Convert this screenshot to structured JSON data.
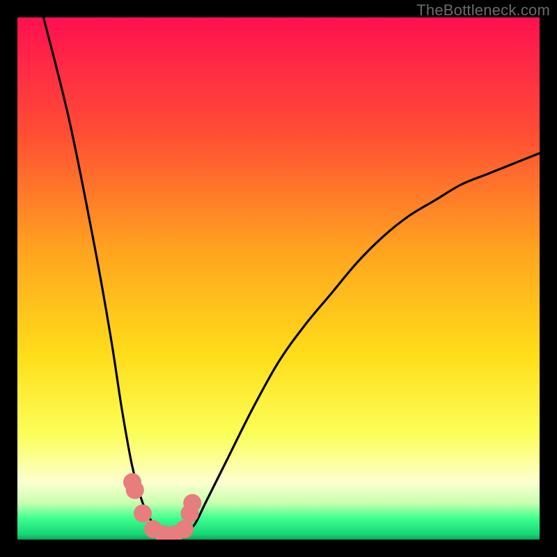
{
  "watermark": "TheBottleneck.com",
  "colors": {
    "page_bg": "#000000",
    "gradient_top": "#ff1050",
    "gradient_mid1": "#ff5030",
    "gradient_mid2": "#ffa81f",
    "gradient_mid3": "#ffe21a",
    "gradient_mid4": "#fcff60",
    "gradient_pale": "#fdffd8",
    "gradient_green": "#18ff82",
    "gradient_dark_bottom": "#0cb35a",
    "curve": "#000000",
    "marker_fill": "#e77d7d"
  },
  "chart_data": {
    "type": "line",
    "title": "",
    "xlabel": "",
    "ylabel": "",
    "xlim": [
      0,
      100
    ],
    "ylim": [
      0,
      100
    ],
    "series": [
      {
        "name": "bottleneck-curve",
        "x": [
          5,
          10,
          15,
          18,
          20,
          22,
          24,
          26,
          28,
          30,
          32,
          34,
          36,
          40,
          45,
          50,
          55,
          60,
          65,
          70,
          75,
          80,
          85,
          90,
          95,
          100
        ],
        "values": [
          100,
          80,
          55,
          38,
          25,
          14,
          7,
          3,
          1,
          0,
          1,
          3,
          7,
          15,
          25,
          34,
          41,
          47,
          53,
          58,
          62,
          65,
          68,
          70,
          72,
          74
        ]
      }
    ],
    "markers": {
      "name": "highlighted-points",
      "x": [
        22,
        22.5,
        24,
        26,
        28,
        30,
        32,
        33,
        33.5
      ],
      "values": [
        11,
        9.5,
        5,
        2,
        1,
        1,
        2,
        5,
        7
      ]
    },
    "minimum_x": 29
  }
}
